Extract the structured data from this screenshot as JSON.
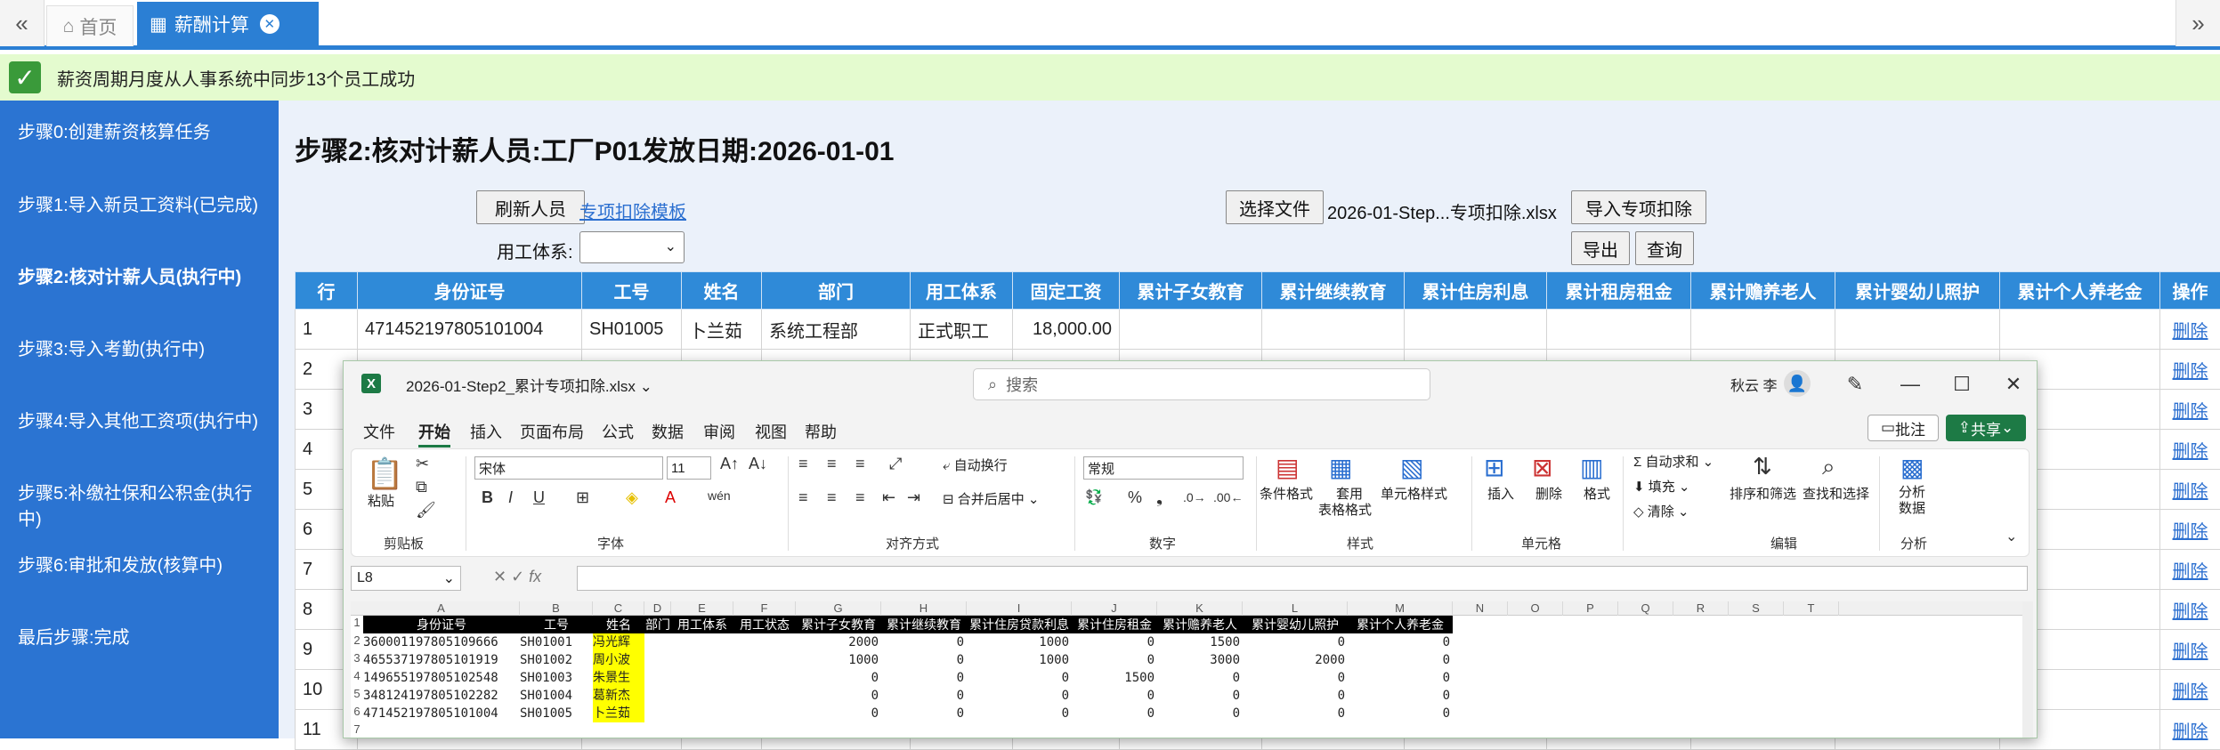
{
  "tabs": {
    "home": "首页",
    "salary": "薪酬计算"
  },
  "message": "薪资周期月度从人事系统中同步13个员工成功",
  "sidebar": {
    "steps": [
      "步骤0:创建薪资核算任务",
      "步骤1:导入新员工资料(已完成)",
      "步骤2:核对计薪人员(执行中)",
      "步骤3:导入考勤(执行中)",
      "步骤4:导入其他工资项(执行中)",
      "步骤5:补缴社保和公积金(执行中)",
      "步骤6:审批和发放(核算中)",
      "最后步骤:完成"
    ]
  },
  "main": {
    "title": "步骤2:核对计薪人员:工厂P01发放日期:2026-01-01",
    "refresh_button": "刷新人员",
    "template_link": "专项扣除模板",
    "work_type_label": "用工体系:",
    "choose_file_button": "选择文件",
    "file_name": "2026-01-Step...专项扣除.xlsx",
    "import_button": "导入专项扣除",
    "export_button": "导出",
    "query_button": "查询"
  },
  "grid": {
    "headers": [
      "行",
      "身份证号",
      "工号",
      "姓名",
      "部门",
      "用工体系",
      "固定工资",
      "累计子女教育",
      "累计继续教育",
      "累计住房利息",
      "累计租房租金",
      "累计赡养老人",
      "累计婴幼儿照护",
      "累计个人养老金",
      "操作"
    ],
    "rows": [
      {
        "row": "1",
        "id": "471452197805101004",
        "emp_no": "SH01005",
        "name": "卜兰茹",
        "dept": "系统工程部",
        "work_type": "正式职工",
        "salary": "18,000.00"
      },
      {
        "row": "2"
      },
      {
        "row": "3"
      },
      {
        "row": "4"
      },
      {
        "row": "5"
      },
      {
        "row": "6"
      },
      {
        "row": "7"
      },
      {
        "row": "8"
      },
      {
        "row": "9"
      },
      {
        "row": "10"
      },
      {
        "row": "11"
      }
    ],
    "action_label": "删除"
  },
  "excel": {
    "filename": "2026-01-Step2_累计专项扣除.xlsx",
    "search_placeholder": "搜索",
    "user": "秋云 李",
    "menu": [
      "文件",
      "开始",
      "插入",
      "页面布局",
      "公式",
      "数据",
      "审阅",
      "视图",
      "帮助"
    ],
    "comment_button": "批注",
    "share_button": "共享",
    "ribbon": {
      "paste": "粘贴",
      "clipboard": "剪贴板",
      "font_name": "宋体",
      "font_size": "11",
      "font": "字体",
      "wrap": "自动换行",
      "merge": "合并后居中",
      "alignment": "对齐方式",
      "number_format": "常规",
      "number": "数字",
      "cond_format": "条件格式",
      "table_format_1": "套用",
      "table_format_2": "表格格式",
      "cell_style": "单元格样式",
      "styles": "样式",
      "insert": "插入",
      "delete": "删除",
      "format": "格式",
      "cells": "单元格",
      "autosum": "自动求和",
      "fill": "填充",
      "clear": "清除",
      "sort_filter": "排序和筛选",
      "find_select": "查找和选择",
      "editing": "编辑",
      "analyze_1": "分析",
      "analyze_2": "数据",
      "analysis": "分析"
    },
    "name_box": "L8",
    "fx": "fx",
    "columns": [
      "A",
      "B",
      "C",
      "D",
      "E",
      "F",
      "G",
      "H",
      "I",
      "J",
      "K",
      "L",
      "M",
      "N",
      "O",
      "P",
      "Q",
      "R",
      "S",
      "T"
    ],
    "sheet_headers": [
      "身份证号",
      "工号",
      "姓名",
      "部门",
      "用工体系",
      "用工状态",
      "累计子女教育",
      "累计继续教育",
      "累计住房贷款利息",
      "累计住房租金",
      "累计赡养老人",
      "累计婴幼儿照护",
      "累计个人养老金"
    ],
    "sheet_rows": [
      {
        "id": "360001197805109666",
        "no": "SH01001",
        "name": "冯光辉",
        "v": [
          "2000",
          "0",
          "1000",
          "0",
          "1500",
          "0",
          "0"
        ]
      },
      {
        "id": "465537197805101919",
        "no": "SH01002",
        "name": "周小波",
        "v": [
          "1000",
          "0",
          "1000",
          "0",
          "3000",
          "2000",
          "0"
        ]
      },
      {
        "id": "149655197805102548",
        "no": "SH01003",
        "name": "朱景生",
        "v": [
          "0",
          "0",
          "0",
          "1500",
          "0",
          "0",
          "0"
        ]
      },
      {
        "id": "348124197805102282",
        "no": "SH01004",
        "name": "葛新杰",
        "v": [
          "0",
          "0",
          "0",
          "0",
          "0",
          "0",
          "0"
        ]
      },
      {
        "id": "471452197805101004",
        "no": "SH01005",
        "name": "卜兰茹",
        "v": [
          "0",
          "0",
          "0",
          "0",
          "0",
          "0",
          "0"
        ]
      }
    ],
    "row_numbers": [
      "1",
      "2",
      "3",
      "4",
      "5",
      "6",
      "7"
    ]
  }
}
